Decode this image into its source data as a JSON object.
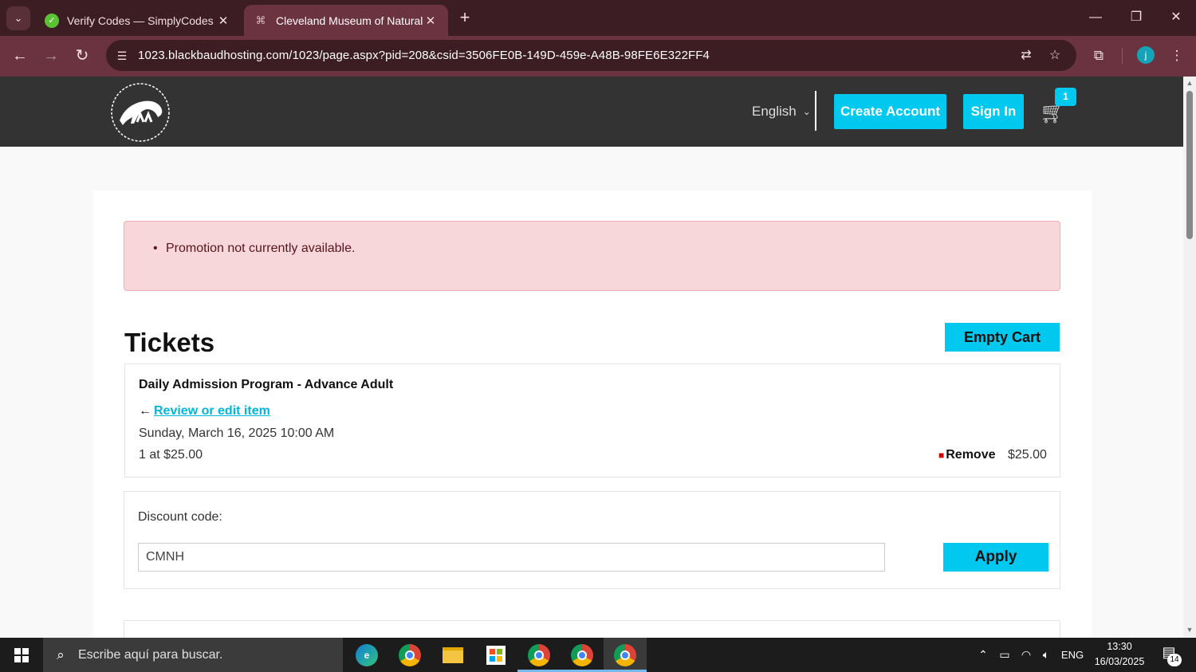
{
  "browser": {
    "tabs": [
      {
        "title": "Verify Codes — SimplyCodes",
        "active": false
      },
      {
        "title": "Cleveland Museum of Natural H",
        "active": true
      }
    ],
    "url": "1023.blackbaudhosting.com/1023/page.aspx?pid=208&csid=3506FE0B-149D-459e-A48B-98FE6E322FF4",
    "profile_initial": "j",
    "colors": {
      "frame": "#3c1d23",
      "toolbar": "#6b3240"
    }
  },
  "header": {
    "logo_text": "CLEVELAND MUSEUM OF NATURAL HISTORY",
    "language": "English",
    "create_account": "Create Account",
    "sign_in": "Sign In",
    "cart_count": "1",
    "accent_color": "#00c8ef"
  },
  "alert": {
    "message": "Promotion not currently available."
  },
  "tickets": {
    "title": "Tickets",
    "empty_cart": "Empty Cart",
    "item": {
      "name": "Daily Admission Program - Advance Adult",
      "review_link": "Review or edit item",
      "date": "Sunday, March 16, 2025 10:00 AM",
      "quantity": "1 at $25.00",
      "remove": "Remove",
      "price": "$25.00"
    }
  },
  "discount": {
    "label": "Discount code:",
    "value": "CMNH",
    "apply": "Apply"
  },
  "taskbar": {
    "search_placeholder": "Escribe aquí para buscar.",
    "language": "ENG",
    "time": "13:30",
    "date": "16/03/2025",
    "notifications": "14"
  }
}
